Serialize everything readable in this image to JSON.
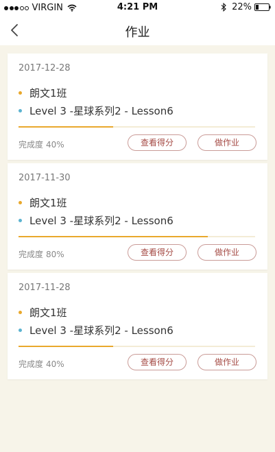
{
  "status_bar": {
    "carrier": "VIRGIN",
    "time": "4:21 PM",
    "battery": "22%",
    "signal_strength": 3,
    "signal_max": 5,
    "battery_level": 0.22,
    "icons": [
      "wifi-icon",
      "bluetooth-icon",
      "battery-icon"
    ]
  },
  "nav": {
    "title": "作业",
    "back_icon": "chevron-left-icon"
  },
  "colors": {
    "accent": "#e9a82c",
    "bullet_class": "#e9a82c",
    "bullet_lesson": "#5bb3d0",
    "button_text": "#a54b45",
    "button_border": "#c99a96",
    "background": "#f7f4e9"
  },
  "assignments": [
    {
      "date": "2017-12-28",
      "class_name": "朗文1班",
      "lesson": "Level 3 -星球系列2 - Lesson6",
      "completion_label": "完成度",
      "completion_text": "40%",
      "completion": 0.4,
      "score_button": "查看得分",
      "do_button": "做作业"
    },
    {
      "date": "2017-11-30",
      "class_name": "朗文1班",
      "lesson": "Level 3 -星球系列2 - Lesson6",
      "completion_label": "完成度",
      "completion_text": "80%",
      "completion": 0.8,
      "score_button": "查看得分",
      "do_button": "做作业"
    },
    {
      "date": "2017-11-28",
      "class_name": "朗文1班",
      "lesson": "Level 3 -星球系列2 - Lesson6",
      "completion_label": "完成度",
      "completion_text": "40%",
      "completion": 0.4,
      "score_button": "查看得分",
      "do_button": "做作业"
    }
  ]
}
